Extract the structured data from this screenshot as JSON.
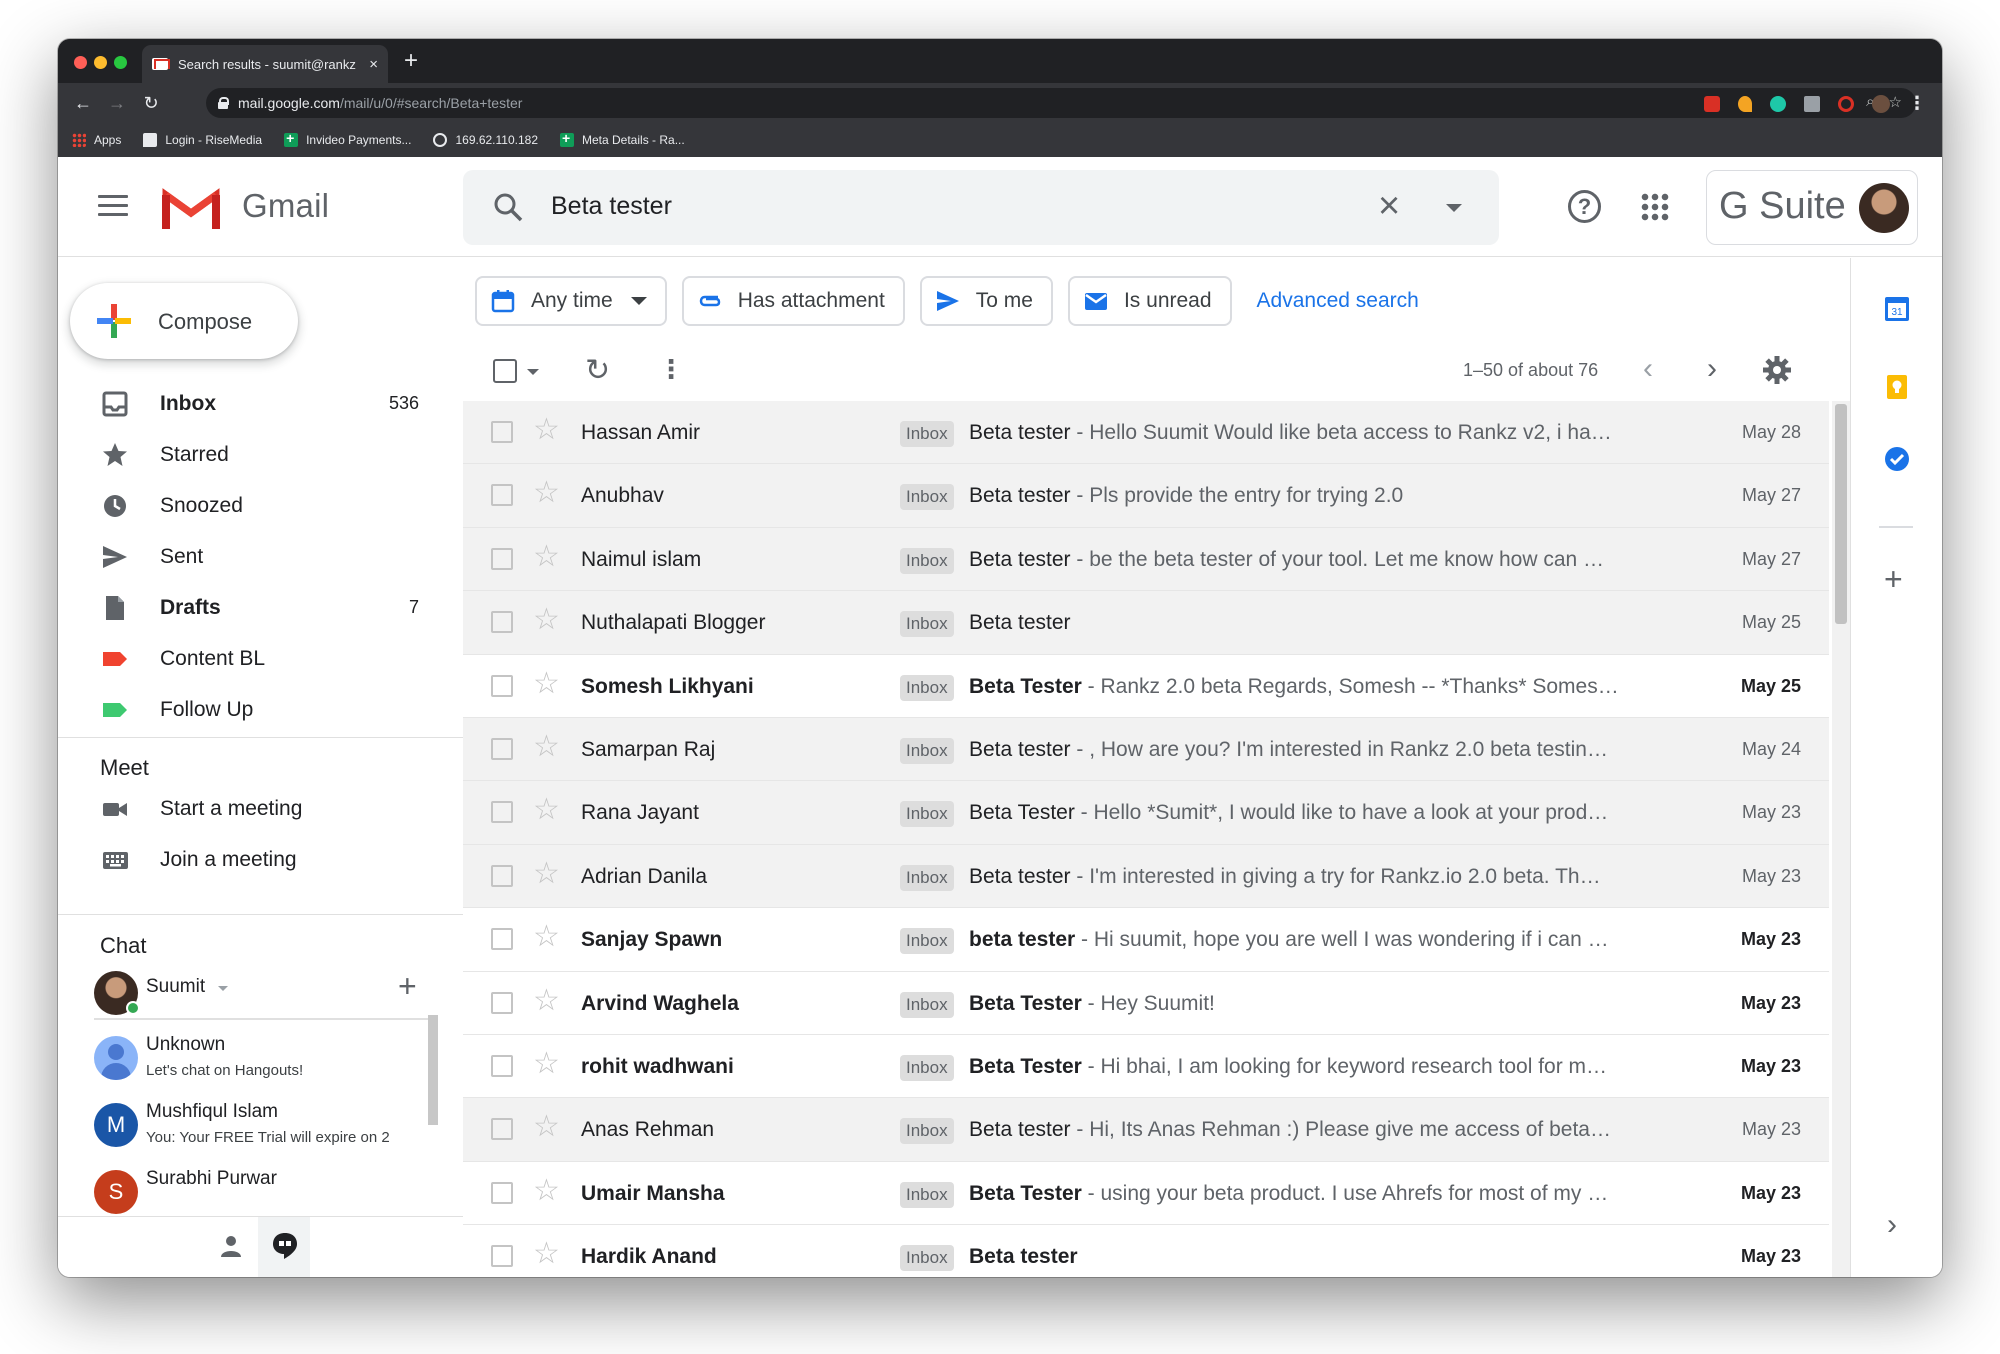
{
  "browser": {
    "tab_title": "Search results - suumit@rankz",
    "tab_close": "×",
    "new_tab": "+",
    "url_host": "mail.google.com",
    "url_path": "/mail/u/0/#search/Beta+tester",
    "bookmarks": [
      {
        "label": "Apps",
        "icon": "apps-grid-icon"
      },
      {
        "label": "Login - RiseMedia",
        "icon": "message-icon"
      },
      {
        "label": "Invideo Payments...",
        "icon": "plus-sheet-icon"
      },
      {
        "label": "169.62.110.182",
        "icon": "globe-icon"
      },
      {
        "label": "Meta Details - Ra...",
        "icon": "plus-sheet-icon"
      }
    ]
  },
  "header": {
    "app_name": "Gmail",
    "search_query": "Beta tester",
    "account_brand": "G Suite",
    "help_glyph": "?"
  },
  "compose": {
    "label": "Compose"
  },
  "nav": [
    {
      "label": "Inbox",
      "count": "536",
      "bold": true,
      "icon": "inbox-icon"
    },
    {
      "label": "Starred",
      "count": "",
      "bold": false,
      "icon": "star-icon"
    },
    {
      "label": "Snoozed",
      "count": "",
      "bold": false,
      "icon": "clock-icon"
    },
    {
      "label": "Sent",
      "count": "",
      "bold": false,
      "icon": "send-icon"
    },
    {
      "label": "Drafts",
      "count": "7",
      "bold": true,
      "icon": "draft-icon"
    },
    {
      "label": "Content BL",
      "count": "",
      "bold": false,
      "icon": "label-icon",
      "color": "#f0432f"
    },
    {
      "label": "Follow Up",
      "count": "",
      "bold": false,
      "icon": "label-icon",
      "color": "#3ec970"
    }
  ],
  "meet": {
    "title": "Meet",
    "items": [
      {
        "label": "Start a meeting",
        "icon": "video-camera-icon"
      },
      {
        "label": "Join a meeting",
        "icon": "keyboard-icon"
      }
    ]
  },
  "chat": {
    "title": "Chat",
    "user": "Suumit",
    "contacts": [
      {
        "name": "Unknown",
        "sub": "Let's chat on Hangouts!",
        "initial": "",
        "color": "#8ab4f8"
      },
      {
        "name": "Mushfiqul Islam",
        "sub": "You: Your FREE Trial will expire on 2",
        "initial": "M",
        "color": "#1a56a7"
      },
      {
        "name": "Surabhi Purwar",
        "sub": "",
        "initial": "S",
        "color": "#c53d1c"
      }
    ]
  },
  "filters": {
    "chips": [
      {
        "label": "Any time",
        "icon": "calendar-icon",
        "dropdown": true
      },
      {
        "label": "Has attachment",
        "icon": "paperclip-icon",
        "dropdown": false
      },
      {
        "label": "To me",
        "icon": "send-arrow-icon",
        "dropdown": false
      },
      {
        "label": "Is unread",
        "icon": "unread-mail-icon",
        "dropdown": false
      }
    ],
    "advanced": "Advanced search"
  },
  "toolbar": {
    "range": "1–50 of about 76"
  },
  "emails": [
    {
      "sender": "Hassan Amir",
      "label": "Inbox",
      "subject": "Beta tester",
      "snippet": " - Hello Suumit Would like beta access to Rankz v2, i ha…",
      "date": "May 28",
      "unread": false
    },
    {
      "sender": "Anubhav",
      "label": "Inbox",
      "subject": "Beta tester",
      "snippet": " - Pls provide the entry for trying 2.0",
      "date": "May 27",
      "unread": false
    },
    {
      "sender": "Naimul islam",
      "label": "Inbox",
      "subject": "Beta tester",
      "snippet": " - be the beta tester of your tool. Let me know how can …",
      "date": "May 27",
      "unread": false
    },
    {
      "sender": "Nuthalapati Blogger",
      "label": "Inbox",
      "subject": "Beta tester",
      "snippet": "",
      "date": "May 25",
      "unread": false
    },
    {
      "sender": "Somesh Likhyani",
      "label": "Inbox",
      "subject": "Beta Tester",
      "snippet": " - Rankz 2.0 beta Regards, Somesh -- *Thanks* Somes…",
      "date": "May 25",
      "unread": true
    },
    {
      "sender": "Samarpan Raj",
      "label": "Inbox",
      "subject": "Beta tester",
      "snippet": " - , How are you? I'm interested in Rankz 2.0 beta testin…",
      "date": "May 24",
      "unread": false
    },
    {
      "sender": "Rana Jayant",
      "label": "Inbox",
      "subject": "Beta Tester",
      "snippet": " - Hello *Sumit*, I would like to have a look at your prod…",
      "date": "May 23",
      "unread": false
    },
    {
      "sender": "Adrian Danila",
      "label": "Inbox",
      "subject": "Beta tester",
      "snippet": " - I'm interested in giving a try for Rankz.io 2.0 beta. Th…",
      "date": "May 23",
      "unread": false
    },
    {
      "sender": "Sanjay Spawn",
      "label": "Inbox",
      "subject": "beta tester",
      "snippet": " - Hi suumit, hope you are well I was wondering if i can …",
      "date": "May 23",
      "unread": true
    },
    {
      "sender": "Arvind Waghela",
      "label": "Inbox",
      "subject": "Beta Tester",
      "snippet": " - Hey Suumit!",
      "date": "May 23",
      "unread": true
    },
    {
      "sender": "rohit wadhwani",
      "label": "Inbox",
      "subject": "Beta Tester",
      "snippet": " - Hi bhai, I am looking for keyword research tool for m…",
      "date": "May 23",
      "unread": true
    },
    {
      "sender": "Anas Rehman",
      "label": "Inbox",
      "subject": "Beta tester",
      "snippet": " - Hi, Its Anas Rehman :) Please give me access of beta…",
      "date": "May 23",
      "unread": false
    },
    {
      "sender": "Umair Mansha",
      "label": "Inbox",
      "subject": "Beta Tester",
      "snippet": " - using your beta product. I use Ahrefs for most of my …",
      "date": "May 23",
      "unread": true
    },
    {
      "sender": "Hardik Anand",
      "label": "Inbox",
      "subject": "Beta tester",
      "snippet": "",
      "date": "May 23",
      "unread": true
    }
  ],
  "side_panel": {
    "calendar_day": "31"
  }
}
